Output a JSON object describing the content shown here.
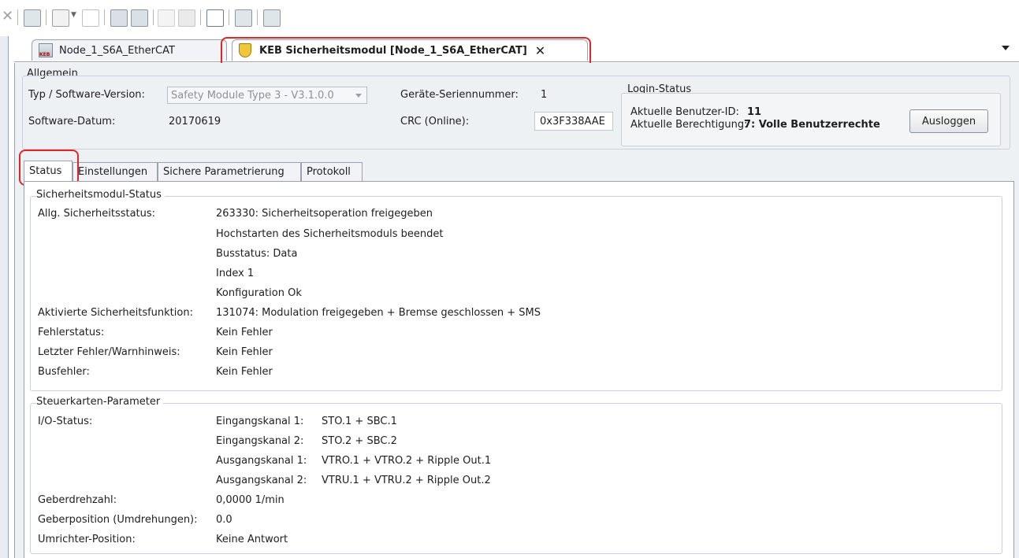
{
  "toolbar": {
    "icons": [
      "close-icon",
      "keb-device-icon",
      "new-icon",
      "open-icon",
      "keb-connect-icon",
      "keb-add-icon",
      "pen-icon",
      "copy-icon",
      "chart-icon",
      "keb-list-icon",
      "keb-network-icon"
    ]
  },
  "tabs": {
    "tab1_label": "Node_1_S6A_EtherCAT",
    "tab2_label": "KEB Sicherheitsmodul [Node_1_S6A_EtherCAT]",
    "close_symbol": "✕"
  },
  "general": {
    "title": "Allgemein",
    "type_label": "Typ / Software-Version:",
    "type_value": "Safety Module Type 3 - V3.1.0.0",
    "date_label": "Software-Datum:",
    "date_value": "20170619",
    "serial_label": "Geräte-Seriennummer:",
    "serial_value": "1",
    "crc_label": "CRC (Online):",
    "crc_value": "0x3F338AAE",
    "login_title": "Login-Status",
    "user_id_label": "Aktuelle Benutzer-ID:",
    "user_id_value": "11",
    "permission_label": "Aktuelle Berechtigung:",
    "permission_value": "7: Volle Benutzerrechte",
    "logout_button": "Ausloggen"
  },
  "inner_tabs": [
    "Status",
    "Einstellungen",
    "Sichere Parametrierung",
    "Protokoll"
  ],
  "status_section": {
    "title": "Sicherheitsmodul-Status",
    "rows": [
      {
        "label": "Allg. Sicherheitsstatus:",
        "value": "263330: Sicherheitsoperation freigegeben"
      },
      {
        "label": "",
        "value": "Hochstarten des Sicherheitsmoduls beendet"
      },
      {
        "label": "",
        "value": "Busstatus: Data"
      },
      {
        "label": "",
        "value": "Index 1"
      },
      {
        "label": "",
        "value": "Konfiguration Ok"
      },
      {
        "label": "Aktivierte Sicherheitsfunktion:",
        "value": "131074: Modulation freigegeben + Bremse geschlossen + SMS"
      },
      {
        "label": "Fehlerstatus:",
        "value": "Kein Fehler"
      },
      {
        "label": "Letzter Fehler/Warnhinweis:",
        "value": "Kein Fehler"
      },
      {
        "label": "Busfehler:",
        "value": "Kein Fehler"
      }
    ]
  },
  "control_section": {
    "title": "Steuerkarten-Parameter",
    "io_label": "I/O-Status:",
    "channels": [
      {
        "name": "Eingangskanal 1:",
        "value": "STO.1 + SBC.1"
      },
      {
        "name": "Eingangskanal 2:",
        "value": "STO.2 + SBC.2"
      },
      {
        "name": "Ausgangskanal 1:",
        "value": "VTRO.1 + VTRO.2 + Ripple Out.1"
      },
      {
        "name": "Ausgangskanal 2:",
        "value": "VTRU.1 + VTRU.2 + Ripple Out.2"
      }
    ],
    "speed_label": "Geberdrehzahl:",
    "speed_value": "0,0000 1/min",
    "position_label": "Geberposition (Umdrehungen):",
    "position_value": "0.0",
    "inverter_label": "Umrichter-Position:",
    "inverter_value": "Keine Antwort"
  },
  "colors": {
    "highlight": "#e0262b",
    "panel_bg": "#eef1f4",
    "border": "#9aa3ad"
  }
}
